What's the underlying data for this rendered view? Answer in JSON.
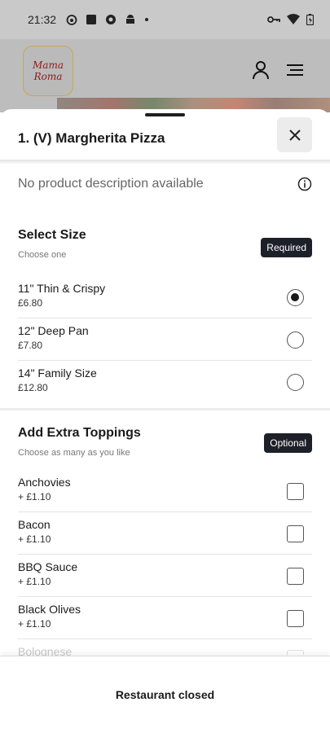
{
  "status_bar": {
    "time": "21:32"
  },
  "background_app": {
    "logo_line1": "Mama",
    "logo_line2": "Roma"
  },
  "sheet": {
    "title": "1. (V) Margherita Pizza",
    "description": "No product description available",
    "size_section": {
      "title": "Select Size",
      "subtitle": "Choose one",
      "badge": "Required",
      "options": [
        {
          "name": "11\" Thin & Crispy",
          "price": "£6.80",
          "selected": true
        },
        {
          "name": "12\" Deep Pan",
          "price": "£7.80",
          "selected": false
        },
        {
          "name": "14\" Family Size",
          "price": "£12.80",
          "selected": false
        }
      ]
    },
    "toppings_section": {
      "title": "Add Extra Toppings",
      "subtitle": "Choose as many as you like",
      "badge": "Optional",
      "options": [
        {
          "name": "Anchovies",
          "price": "+ £1.10"
        },
        {
          "name": "Bacon",
          "price": "+ £1.10"
        },
        {
          "name": "BBQ Sauce",
          "price": "+ £1.10"
        },
        {
          "name": "Black Olives",
          "price": "+ £1.10"
        },
        {
          "name": "Bolognese",
          "price": ""
        }
      ]
    }
  },
  "footer": {
    "status": "Restaurant closed"
  }
}
